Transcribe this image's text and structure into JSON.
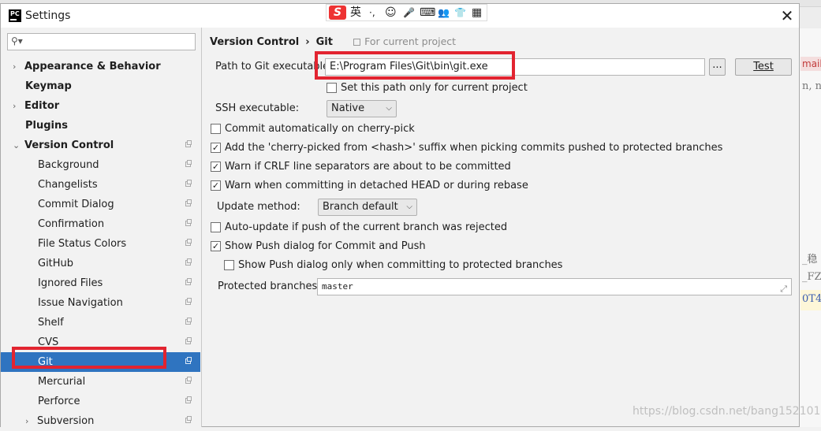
{
  "window": {
    "title": "Settings",
    "close_glyph": "✕",
    "app_logo": "PC"
  },
  "ime_toolbar": {
    "logo": "S",
    "lang": "英",
    "items": [
      "·,",
      "☺",
      "🎤",
      "⌨",
      "👥",
      "👕",
      "▦"
    ]
  },
  "background_window": {
    "lines": [
      "mail",
      "n, na",
      "_稳",
      "_FZ_",
      "0T4"
    ]
  },
  "sidebar": {
    "search": {
      "placeholder": "",
      "value": "",
      "icon": "search-icon"
    },
    "items": [
      {
        "label": "Appearance & Behavior",
        "bold": true,
        "arrow": "›",
        "level": 0
      },
      {
        "label": "Keymap",
        "bold": true,
        "level": 0
      },
      {
        "label": "Editor",
        "bold": true,
        "arrow": "›",
        "level": 0
      },
      {
        "label": "Plugins",
        "bold": true,
        "level": 0
      },
      {
        "label": "Version Control",
        "bold": true,
        "arrow": "⌄",
        "level": 0,
        "project_icon": true
      },
      {
        "label": "Background",
        "level": 1,
        "project_icon": true
      },
      {
        "label": "Changelists",
        "level": 1,
        "project_icon": true
      },
      {
        "label": "Commit Dialog",
        "level": 1,
        "project_icon": true
      },
      {
        "label": "Confirmation",
        "level": 1,
        "project_icon": true
      },
      {
        "label": "File Status Colors",
        "level": 1,
        "project_icon": true
      },
      {
        "label": "GitHub",
        "level": 1,
        "project_icon": true
      },
      {
        "label": "Ignored Files",
        "level": 1,
        "project_icon": true
      },
      {
        "label": "Issue Navigation",
        "level": 1,
        "project_icon": true
      },
      {
        "label": "Shelf",
        "level": 1,
        "project_icon": true
      },
      {
        "label": "CVS",
        "level": 1,
        "project_icon": true
      },
      {
        "label": "Git",
        "level": 1,
        "project_icon": true,
        "selected": true
      },
      {
        "label": "Mercurial",
        "level": 1,
        "project_icon": true
      },
      {
        "label": "Perforce",
        "level": 1,
        "project_icon": true
      },
      {
        "label": "Subversion",
        "level": 1,
        "arrow": "›",
        "project_icon": true
      }
    ]
  },
  "content": {
    "breadcrumb": {
      "parent": "Version Control",
      "separator": "›",
      "current": "Git",
      "scope": "For current project"
    },
    "git_path": {
      "label": "Path to Git executable:",
      "value": "E:\\Program Files\\Git\\bin\\git.exe",
      "browse": "...",
      "test": "Test"
    },
    "set_path_only": {
      "label": "Set this path only for current project",
      "checked": false
    },
    "ssh": {
      "label": "SSH executable:",
      "value": "Native"
    },
    "options": [
      {
        "label": "Commit automatically on cherry-pick",
        "checked": false
      },
      {
        "label": "Add the 'cherry-picked from <hash>' suffix when picking commits pushed to protected branches",
        "checked": true
      },
      {
        "label": "Warn if CRLF line separators are about to be committed",
        "checked": true
      },
      {
        "label": "Warn when committing in detached HEAD or during rebase",
        "checked": true
      }
    ],
    "update_method": {
      "label": "Update method:",
      "value": "Branch default"
    },
    "auto_update": {
      "label": "Auto-update if push of the current branch was rejected",
      "checked": false
    },
    "show_push": {
      "label": "Show Push dialog for Commit and Push",
      "checked": true
    },
    "show_push_protected": {
      "label": "Show Push dialog only when committing to protected branches",
      "checked": false
    },
    "protected_branches": {
      "label": "Protected branches:",
      "value": "master"
    }
  },
  "watermark": "https://blog.csdn.net/bang152101",
  "colors": {
    "selection": "#2f74c0",
    "highlight_box": "#e22430"
  }
}
